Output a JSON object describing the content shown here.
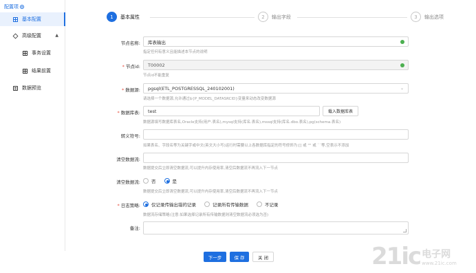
{
  "sidebar": {
    "header": "配置项",
    "items": [
      {
        "label": "基本配置",
        "icon": "grid-icon",
        "active": true
      },
      {
        "label": "高级配置",
        "icon": "cube-icon",
        "expanded": true
      },
      {
        "label": "事务设置",
        "icon": "grid-icon"
      },
      {
        "label": "结果前置",
        "icon": "grid-icon"
      },
      {
        "label": "数据预览",
        "icon": "db-icon"
      }
    ]
  },
  "steps": [
    {
      "num": "1",
      "label": "基本属性",
      "state": "active"
    },
    {
      "num": "2",
      "label": "输出字段",
      "state": "inactive"
    },
    {
      "num": "3",
      "label": "输出选项",
      "state": "inactive"
    }
  ],
  "form": {
    "node_name": {
      "label": "节点名称:",
      "value": "库表输出",
      "hint": "指定任何有意义且能描述本节点的说明"
    },
    "node_id": {
      "label": "节点id:",
      "value": "T00002",
      "hint": "节点id不能重复"
    },
    "datasource": {
      "label": "数据源:",
      "value": "pgsql(ETL_POSTGRESSQL_240102001)",
      "hint": "请选择一个数据源,允许通过${P_MODEL_DATASRCID}变量来动态改变数据源"
    },
    "table_name": {
      "label": "数据库表:",
      "value": "test",
      "button": "载入数据库表",
      "hint": "数据源填写数据库表名,Oracle支持(用户.表名),mysql支持(库名.表名),mssql支持(库名.dbo.表名),pg(schema.表名)"
    },
    "escape_char": {
      "label": "转义符号:",
      "value": "",
      "hint": "如果表名、字段名等为关键字或中文(英文大小写)运行时需要以上各数据库指定的符号修饰为:[] 或 \"\" 或 ``等,空表示不添加"
    },
    "clear_data_flow": {
      "label": "清空数据流:",
      "value": "",
      "hint": "数据提交后立即清空数据流,可以提升内存使用率,清空后数据流不再流入下一节点"
    },
    "clear_data_flow2": {
      "label": "清空数据流:",
      "options": [
        "否",
        "是"
      ],
      "selected": "是",
      "hint": "数据提交后立即清空数据流,可以提升内存使用率,清空后数据流不再流入下一节点"
    },
    "log_strategy": {
      "label": "日志策略:",
      "options": [
        "仅记录传输出错的记录",
        "记录所有传输数据",
        "不记录"
      ],
      "selected": "仅记录传输出错的记录",
      "hint": "数据流存储策略(注意:如果选择记录所有传输数据则清空数据流必须选为否)"
    },
    "remark": {
      "label": "备注:",
      "value": ""
    }
  },
  "footer": {
    "next": "下一步",
    "save": "保 存",
    "close": "关 闭"
  },
  "watermark": {
    "big": "21ic",
    "cn": "电子网",
    "url": "www.21ic.com"
  },
  "colors": {
    "accent": "#1e6fe0",
    "ok": "#4caf50",
    "required": "#e74c3c"
  }
}
